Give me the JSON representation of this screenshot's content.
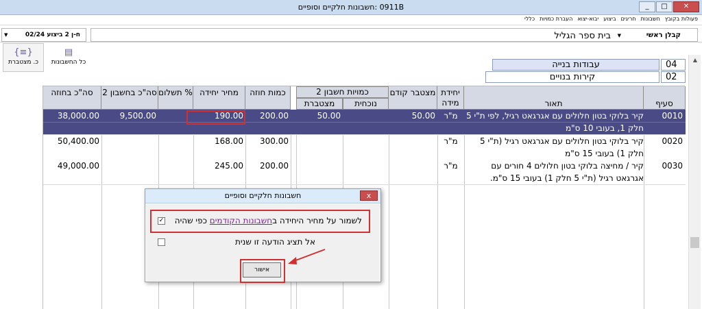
{
  "window": {
    "title": "0911B :חשבונות חלקיים וסופיים",
    "btn_min": "_",
    "btn_max": "□",
    "btn_close": "✕"
  },
  "menu": {
    "items": [
      "פעולות בקובץ",
      "חשבונות",
      "חריגים",
      "ביצוע",
      "יבוא-יצוא",
      "העברת כמויות",
      "כללי"
    ]
  },
  "topbar": {
    "project": "בית ספר הגליל",
    "role": "קבלן ראשי",
    "left_combo": "ח-ן 2 ביצוע 02/24"
  },
  "toolbar": {
    "all_accounts": "כל החשבונות",
    "cumulative": "כ. מצטברת"
  },
  "codes": {
    "chapter_num": "04",
    "chapter_name": "עבודות בנייה",
    "sub_num": "02",
    "sub_name": "קירות בנויים"
  },
  "table": {
    "headers": {
      "section": "סעיף",
      "desc": "תאור",
      "unit": "יחידת מידה",
      "prev_cum": "מצטבר קודם",
      "group": "כמויות חשבון 2",
      "current": "נוכחית",
      "cumulative": "מצטברת",
      "qty_contract": "כמות חוזה",
      "unit_price": "מחיר יחידה",
      "pct": "% תשלום",
      "total_acct": "סה\"כ בחשבון 2",
      "total_contract": "סה\"כ בחוזה"
    },
    "rows": [
      {
        "section": "0010",
        "desc": "קיר בלוקי בטון חלולים עם אגרגאט רגיל, לפי ת\"י 5 חלק 1, בעובי 10 ס\"מ",
        "unit": "מ\"ר",
        "prev": "50.00",
        "current": "",
        "cum": "50.00",
        "qty": "200.00",
        "price": "190.00",
        "pct": "",
        "total_acct": "9,500.00",
        "total_contract": "38,000.00"
      },
      {
        "section": "0020",
        "desc": "קיר בלוקי בטון חלולים עם אגרגאט רגיל (ת\"י 5 חלק 1) בעובי 15 ס\"מ",
        "unit": "מ\"ר",
        "prev": "",
        "current": "",
        "cum": "",
        "qty": "300.00",
        "price": "168.00",
        "pct": "",
        "total_acct": "",
        "total_contract": "50,400.00"
      },
      {
        "section": "0030",
        "desc": "קיר / מחיצה בלוקי בטון חלולים 4 חורים עם אגרגאט רגיל (ת\"י 5 חלק 1) בעובי 15 ס\"מ.",
        "unit": "מ\"ר",
        "prev": "",
        "current": "",
        "cum": "",
        "qty": "200.00",
        "price": "245.00",
        "pct": "",
        "total_acct": "",
        "total_contract": "49,000.00"
      }
    ]
  },
  "dialog": {
    "title": "חשבונות חלקיים וסופיים",
    "close": "x",
    "opt1_pre": "לשמור על מחיר היחידה ב",
    "opt1_link": "חשבונות הקודמים",
    "opt1_post": " כפי שהיה",
    "opt2": "אל תציג הודעה זו שנית",
    "ok": "אישור",
    "check_mark": "✓"
  },
  "colors": {
    "selected_row": "#4a4b86",
    "header_bg": "#d5d9e4",
    "highlight": "#d23030"
  }
}
